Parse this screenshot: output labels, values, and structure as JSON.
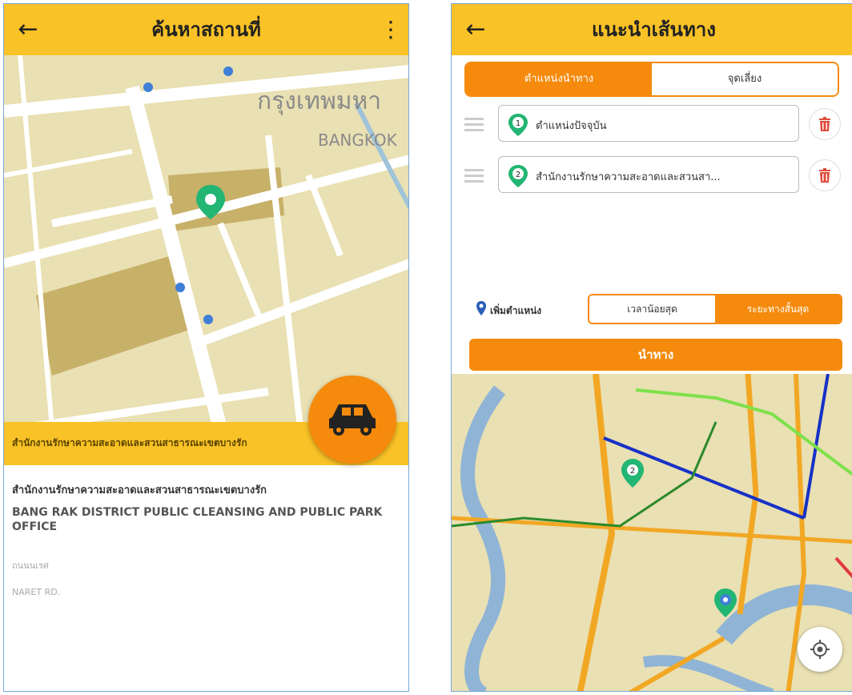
{
  "search_screen": {
    "title": "ค้นหาสถานที่",
    "map_label_th": "กรุงเทพมหา",
    "map_label_en": "BANGKOK",
    "place_banner": "สำนักงานรักษาความสะอาดและสวนสาธารณะเขตบางรัก",
    "place_name_th": "สำนักงานรักษาความสะอาดและสวนสาธารณะเขตบางรัก",
    "place_name_en": "BANG RAK DISTRICT PUBLIC CLEANSING AND PUBLIC PARK OFFICE",
    "road_th": "ถนนนเรศ",
    "road_en": "NARET RD."
  },
  "route_screen": {
    "title": "แนะนำเส้นทาง",
    "tabs": [
      {
        "label": "ตำแหน่งนำทาง",
        "active": true
      },
      {
        "label": "จุดเลี่ยง",
        "active": false
      }
    ],
    "waypoints": [
      {
        "number": "1",
        "label": "ตำแหน่งปัจจุบัน"
      },
      {
        "number": "2",
        "label": "สำนักงานรักษาความสะอาดและสวนสา..."
      }
    ],
    "add_location_label": "เพิ่มตำแหน่ง",
    "route_options": [
      {
        "label": "เวลาน้อยสุด",
        "active": false
      },
      {
        "label": "ระยะทางสั้นสุด",
        "active": true
      }
    ],
    "navigate_label": "นำทาง"
  },
  "colors": {
    "appbar": "#f9c226",
    "accent": "#f58a0c",
    "pin": "#22b573",
    "map_bg": "#e9e0b3"
  },
  "icons": [
    "back-arrow-icon",
    "more-vert-icon",
    "location-pin-icon",
    "car-icon",
    "drag-handle-icon",
    "trash-icon",
    "add-location-icon",
    "my-location-icon"
  ]
}
